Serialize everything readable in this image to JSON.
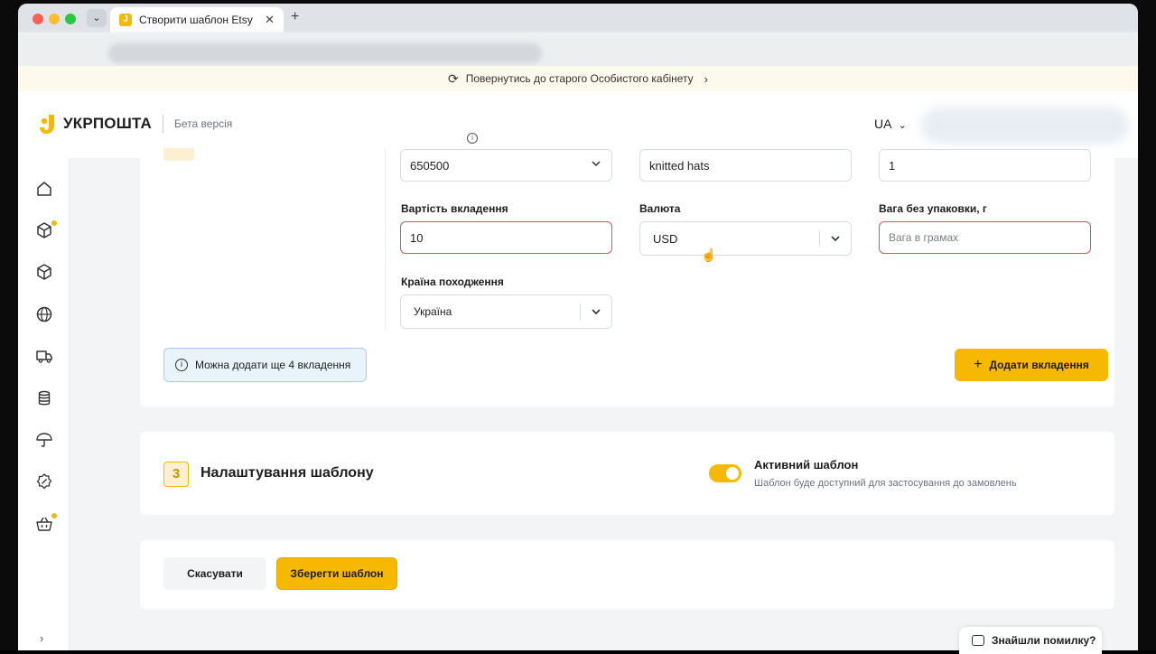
{
  "browser": {
    "tab_title": "Створити шаблон Etsy",
    "tab_close": "✕",
    "new_tab": "+"
  },
  "notice": {
    "text": "Повернутись до старого Особистого кабінету"
  },
  "header": {
    "logo_text": "УКРПОШТА",
    "beta": "Бета версія",
    "lang": "UA"
  },
  "sidebar": {
    "items": [
      {
        "icon": "home-icon"
      },
      {
        "icon": "parcel-new-icon",
        "badge": true
      },
      {
        "icon": "parcel-icon"
      },
      {
        "icon": "globe-icon"
      },
      {
        "icon": "truck-icon"
      },
      {
        "icon": "database-icon"
      },
      {
        "icon": "umbrella-icon"
      },
      {
        "icon": "discount-icon"
      },
      {
        "icon": "basket-icon",
        "badge": true
      }
    ]
  },
  "attachment": {
    "code_value": "650500",
    "description_value": "knitted hats",
    "quantity_value": "1",
    "value_label": "Вартість вкладення",
    "value_value": "10",
    "currency_label": "Валюта",
    "currency_value": "USD",
    "weight_label": "Вага без упаковки, г",
    "weight_placeholder": "Вага в грамах",
    "origin_label": "Країна походження",
    "origin_value": "Україна",
    "info_text": "Можна додати ще 4 вкладення",
    "add_button": "Додати вкладення",
    "add_icon": "+"
  },
  "template_settings": {
    "step": "3",
    "title": "Налаштування шаблону",
    "toggle_title": "Активний шаблон",
    "toggle_sub": "Шаблон буде доступний для застосування до замовлень",
    "toggle_on": true
  },
  "actions": {
    "cancel": "Скасувати",
    "save": "Зберегти шаблон"
  },
  "feedback": {
    "text": "Знайшли помилку?"
  },
  "colors": {
    "accent": "#f6b800",
    "error": "#e0505e",
    "info_bg": "#e8f3fc"
  }
}
